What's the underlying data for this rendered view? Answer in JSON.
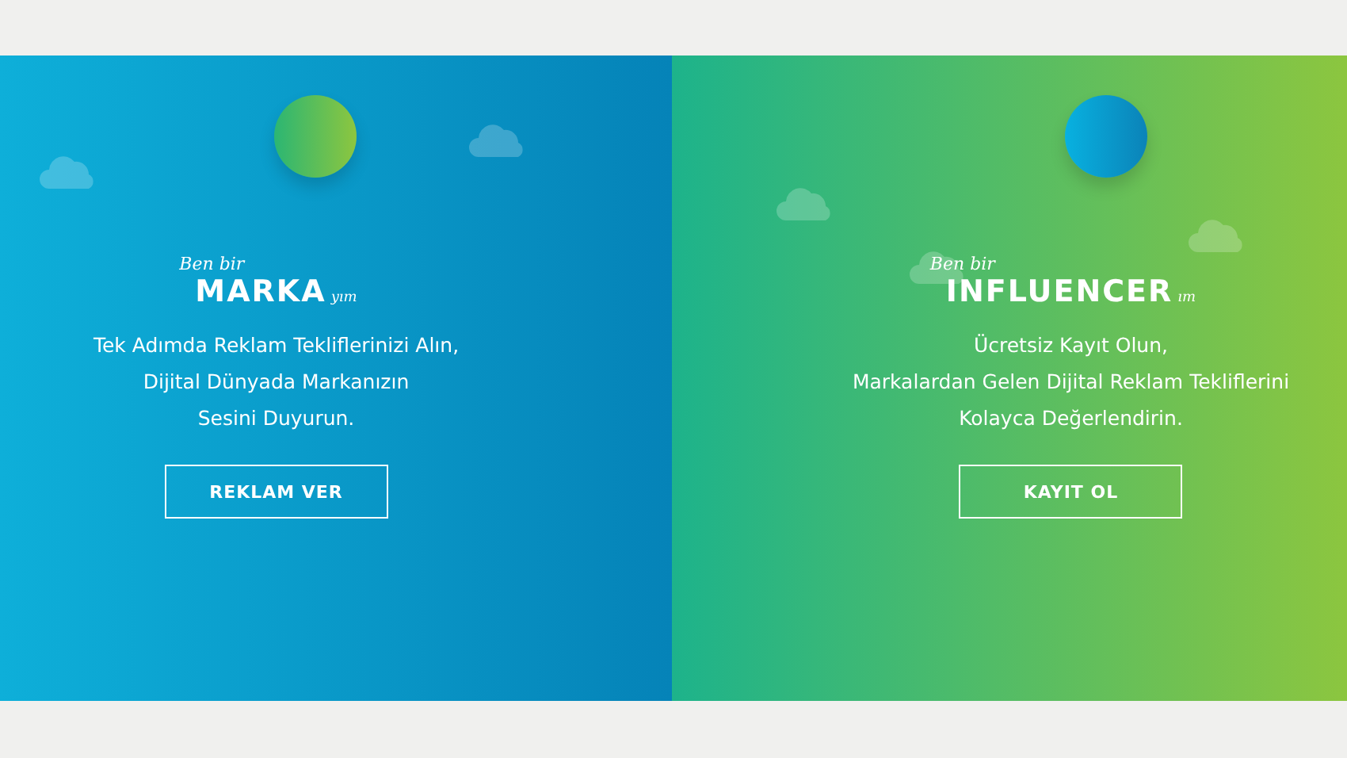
{
  "panels": [
    {
      "kind": "blue",
      "prefix": "Ben bir",
      "title": "MARKA",
      "suffix": "yım",
      "lines": [
        "Tek Adımda Reklam Tekliflerinizi Alın,",
        "Dijital Dünyada Markanızın",
        "Sesini Duyurun."
      ],
      "button": "REKLAM VER"
    },
    {
      "kind": "green",
      "prefix": "Ben bir",
      "title": "INFLUENCER",
      "suffix": "ım",
      "lines": [
        "Ücretsiz Kayıt Olun,",
        "Markalardan Gelen Dijital Reklam Tekliflerini",
        "Kolayca Değerlendirin."
      ],
      "button": "KAYIT OL"
    }
  ]
}
